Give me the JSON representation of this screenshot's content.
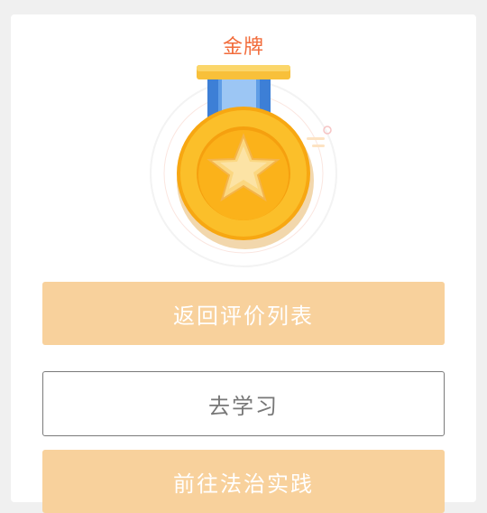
{
  "result": {
    "title": "金牌",
    "medal_icon": "gold-medal-icon"
  },
  "actions": {
    "return_label": "返回评价列表",
    "study_label": "去学习",
    "practice_label": "前往法治实践"
  },
  "colors": {
    "title": "#f26b3a",
    "primary_button": "#f8d19c",
    "outline_border": "#7a7a7a",
    "medal_gold": "#f9b714",
    "ribbon_blue": "#4a90e2"
  }
}
